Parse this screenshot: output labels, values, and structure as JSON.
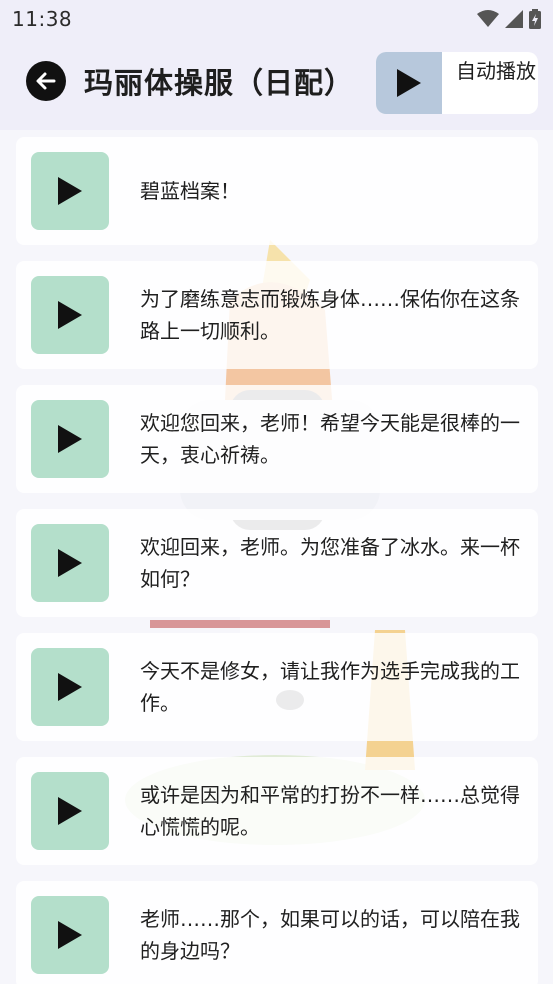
{
  "status_bar": {
    "time": "11:38",
    "icons": [
      "wifi-icon",
      "signal-icon",
      "battery-charging-icon"
    ]
  },
  "app_bar": {
    "back_icon": "arrow-left-icon",
    "title": "玛丽体操服（日配）",
    "autoplay_label": "自动播放"
  },
  "voice_lines": [
    {
      "text": "碧蓝档案！"
    },
    {
      "text": "为了磨练意志而锻炼身体……保佑你在这条路上一切顺利。"
    },
    {
      "text": "欢迎您回来，老师！希望今天能是很棒的一天，衷心祈祷。"
    },
    {
      "text": "欢迎回来，老师。为您准备了冰水。来一杯如何？"
    },
    {
      "text": "今天不是修女，请让我作为选手完成我的工作。"
    },
    {
      "text": "或许是因为和平常的打扮不一样……总觉得心慌慌的呢。"
    },
    {
      "text": "老师……那个，如果可以的话，可以陪在我的身边吗？"
    }
  ],
  "colors": {
    "app_bar_bg": "#efeef9",
    "card_play_bg": "#b4dfcb",
    "autoplay_play_bg": "#b7c8dc",
    "text": "#1f1f1f"
  }
}
